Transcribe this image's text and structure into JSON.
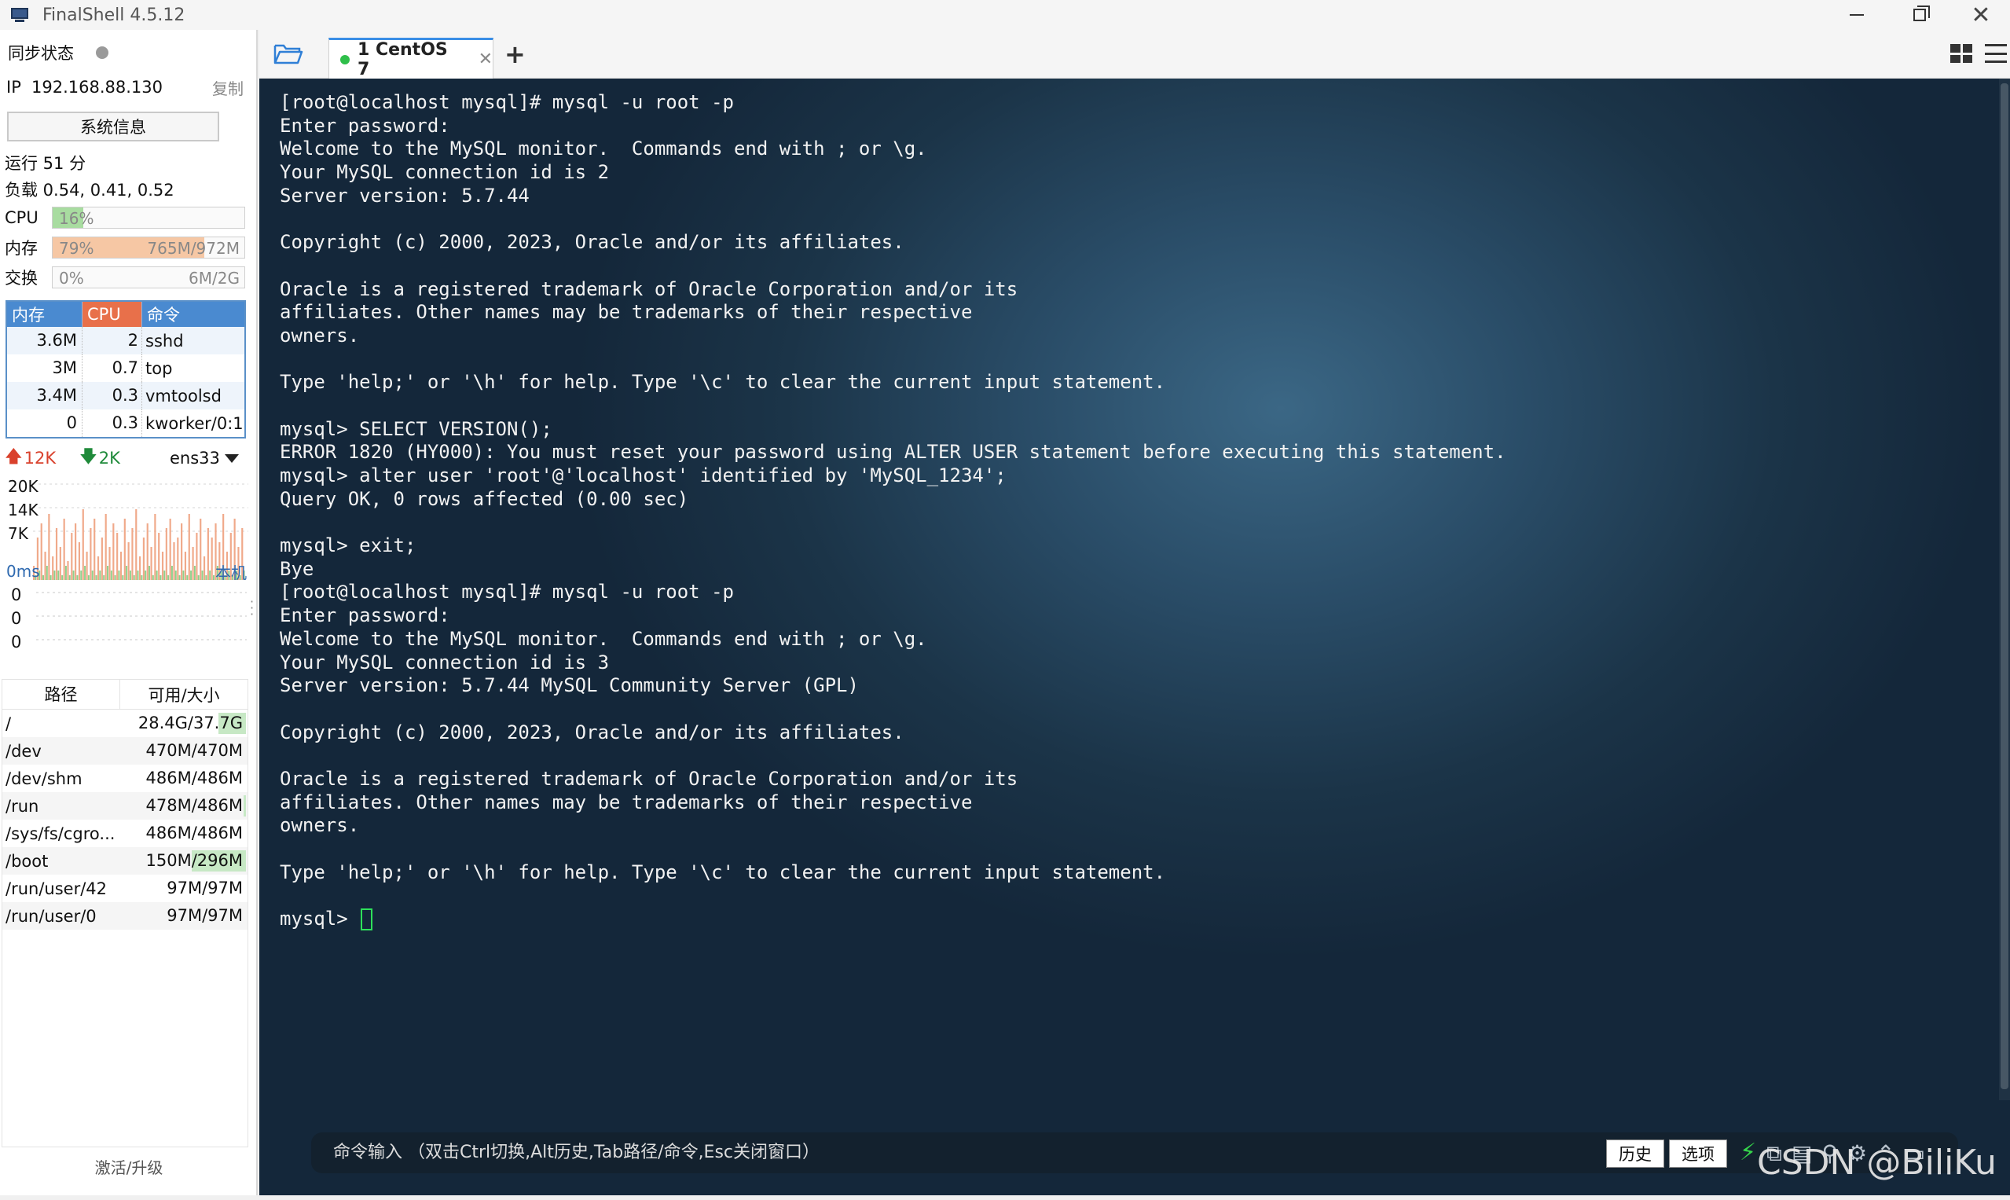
{
  "window": {
    "title": "FinalShell 4.5.12"
  },
  "sidebar": {
    "sync_label": "同步状态",
    "ip_label": "IP",
    "ip_value": "192.168.88.130",
    "copy_label": "复制",
    "sysinfo_label": "系统信息",
    "uptime": "运行 51 分",
    "load": "负载 0.54, 0.41, 0.52",
    "cpu": {
      "label": "CPU",
      "percent_text": "16%",
      "percent": 16,
      "color": "#a8dca0"
    },
    "mem": {
      "label": "内存",
      "percent_text": "79%",
      "percent": 79,
      "amount": "765M/972M",
      "color": "#f6c7a4"
    },
    "swap": {
      "label": "交换",
      "percent_text": "0%",
      "percent": 0,
      "amount": "6M/2G",
      "color": "#dddddd"
    },
    "proc_headers": [
      "内存",
      "CPU",
      "命令"
    ],
    "processes": [
      {
        "mem": "3.6M",
        "cpu": "2",
        "cmd": "sshd"
      },
      {
        "mem": "3M",
        "cpu": "0.7",
        "cmd": "top"
      },
      {
        "mem": "3.4M",
        "cpu": "0.3",
        "cmd": "vmtoolsd"
      },
      {
        "mem": "0",
        "cpu": "0.3",
        "cmd": "kworker/0:1"
      }
    ],
    "net": {
      "up": "12K",
      "down": "2K",
      "interface": "ens33",
      "y_labels": [
        "20K",
        "14K",
        "7K"
      ],
      "upload_series": [
        3,
        9,
        12,
        6,
        14,
        5,
        11,
        7,
        13,
        4,
        10,
        12,
        8,
        15,
        6,
        11,
        13,
        5,
        9,
        14,
        7,
        12,
        10,
        6,
        13,
        8,
        11,
        15,
        5,
        9,
        12,
        7,
        14,
        10,
        6,
        11,
        13,
        8,
        9,
        12,
        6,
        14,
        7,
        10,
        13,
        5,
        11,
        9,
        12,
        8,
        14,
        6,
        10,
        13,
        7,
        11
      ],
      "download_series": [
        1,
        2,
        1,
        3,
        1,
        2,
        2,
        1,
        3,
        1,
        2,
        1,
        2,
        3,
        1,
        2,
        1,
        2,
        1,
        3,
        2,
        1,
        2,
        1,
        3,
        2,
        1,
        2,
        1,
        2,
        3,
        1,
        2,
        1,
        2,
        1,
        3,
        2,
        1,
        2,
        1,
        2,
        3,
        1,
        2,
        1,
        2,
        1,
        3,
        2,
        1,
        2,
        1,
        2,
        1,
        2
      ]
    },
    "ping": {
      "ms": "0ms",
      "host": "本机",
      "values": [
        "0",
        "0",
        "0"
      ]
    },
    "disk_headers": [
      "路径",
      "可用/大小"
    ],
    "disks": [
      {
        "path": "/",
        "usage": "28.4G/37.7G",
        "used_frac": 0.25
      },
      {
        "path": "/dev",
        "usage": "470M/470M",
        "used_frac": 0
      },
      {
        "path": "/dev/shm",
        "usage": "486M/486M",
        "used_frac": 0
      },
      {
        "path": "/run",
        "usage": "478M/486M",
        "used_frac": 0.02
      },
      {
        "path": "/sys/fs/cgro...",
        "usage": "486M/486M",
        "used_frac": 0
      },
      {
        "path": "/boot",
        "usage": "150M/296M",
        "used_frac": 0.49
      },
      {
        "path": "/run/user/42",
        "usage": "97M/97M",
        "used_frac": 0
      },
      {
        "path": "/run/user/0",
        "usage": "97M/97M",
        "used_frac": 0
      }
    ],
    "activate_label": "激活/升级"
  },
  "tabs": [
    {
      "label": "1 CentOS 7",
      "status_color": "#2fbf4a"
    }
  ],
  "terminal": {
    "lines": [
      "[root@localhost mysql]# mysql -u root -p",
      "Enter password:",
      "Welcome to the MySQL monitor.  Commands end with ; or \\g.",
      "Your MySQL connection id is 2",
      "Server version: 5.7.44",
      "",
      "Copyright (c) 2000, 2023, Oracle and/or its affiliates.",
      "",
      "Oracle is a registered trademark of Oracle Corporation and/or its",
      "affiliates. Other names may be trademarks of their respective",
      "owners.",
      "",
      "Type 'help;' or '\\h' for help. Type '\\c' to clear the current input statement.",
      "",
      "mysql> SELECT VERSION();",
      "ERROR 1820 (HY000): You must reset your password using ALTER USER statement before executing this statement.",
      "mysql> alter user 'root'@'localhost' identified by 'MySQL_1234';",
      "Query OK, 0 rows affected (0.00 sec)",
      "",
      "mysql> exit;",
      "Bye",
      "[root@localhost mysql]# mysql -u root -p",
      "Enter password:",
      "Welcome to the MySQL monitor.  Commands end with ; or \\g.",
      "Your MySQL connection id is 3",
      "Server version: 5.7.44 MySQL Community Server (GPL)",
      "",
      "Copyright (c) 2000, 2023, Oracle and/or its affiliates.",
      "",
      "Oracle is a registered trademark of Oracle Corporation and/or its",
      "affiliates. Other names may be trademarks of their respective",
      "owners.",
      "",
      "Type 'help;' or '\\h' for help. Type '\\c' to clear the current input statement.",
      ""
    ],
    "prompt": "mysql> "
  },
  "command_bar": {
    "placeholder": "命令输入 （双击Ctrl切换,Alt历史,Tab路径/命令,Esc关闭窗口）",
    "history_label": "历史",
    "options_label": "选项"
  },
  "watermark": "CSDN @BiliKu"
}
